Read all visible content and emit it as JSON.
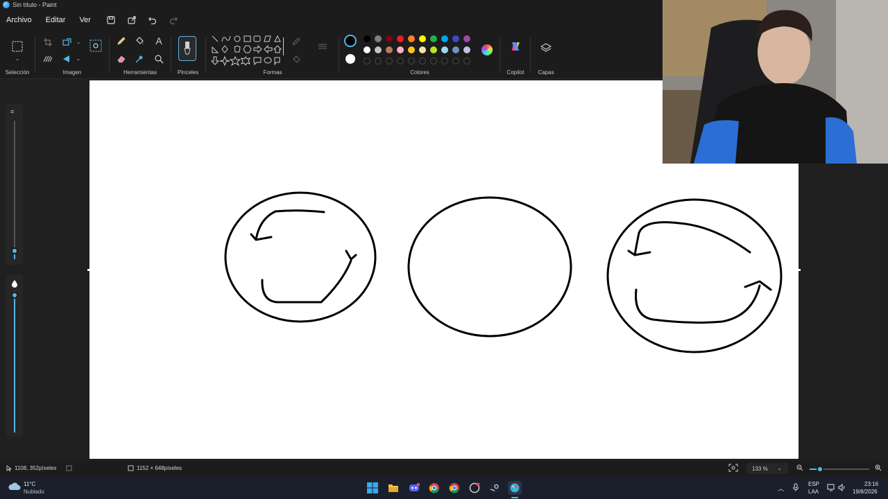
{
  "window": {
    "title": "Sin título - Paint"
  },
  "menu": {
    "items": [
      "Archivo",
      "Editar",
      "Ver"
    ]
  },
  "ribbon": {
    "groups": {
      "selection": "Selección",
      "image": "Imagen",
      "tools": "Herramientas",
      "brushes": "Pinceles",
      "shapes": "Formas",
      "colors": "Colores",
      "copilot": "Copilot",
      "layers": "Capas"
    },
    "palette_row1": [
      "#000000",
      "#7f7f7f",
      "#880015",
      "#ed1c24",
      "#ff7f27",
      "#fff200",
      "#22b14c",
      "#00a2e8",
      "#3f48cc",
      "#a349a4"
    ],
    "palette_row2": [
      "#ffffff",
      "#c3c3c3",
      "#b97a57",
      "#ffaec9",
      "#ffc90e",
      "#efe4b0",
      "#b5e61d",
      "#99d9ea",
      "#7092be",
      "#c8bfe7"
    ],
    "primary_color": "#000000",
    "secondary_color": "#ffffff"
  },
  "status": {
    "cursor_position": "1108, 352píxeles",
    "canvas_size": "1152 × 648píxeles",
    "zoom": "133 %"
  },
  "taskbar": {
    "weather_temp": "11°C",
    "weather_desc": "Nublado",
    "lang_top": "ESP",
    "lang_bottom": "LAA",
    "time": "23:16",
    "date": "19/8/2026"
  }
}
